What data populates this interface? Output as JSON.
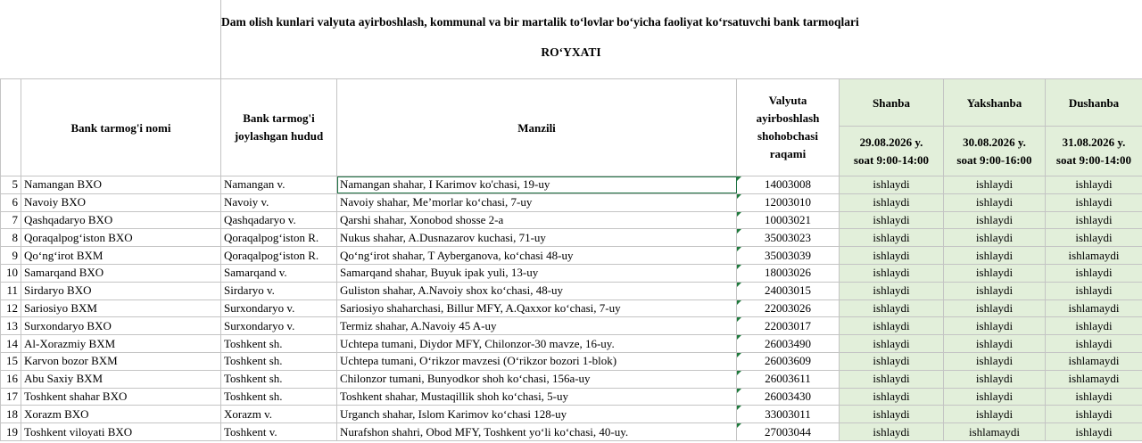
{
  "document": {
    "title": "Dam olish kunlari valyuta ayirboshlash, kommunal va bir martalik toʻlovlar boʻyicha faoliyat koʻrsatuvchi bank tarmoqlari",
    "subtitle": "ROʻYXATI"
  },
  "columns": {
    "bank_name": "Bank tarmog'i nomi",
    "region_line1": "Bank tarmog'i",
    "region_line2": "joylashgan hudud",
    "address": "Manzili",
    "code_line1": "Valyuta",
    "code_line2": "ayirboshlash",
    "code_line3": "shohobchasi",
    "code_line4": "raqami",
    "days": [
      {
        "name": "Shanba",
        "date": "29.08.2026 y.",
        "hours": "soat 9:00-14:00"
      },
      {
        "name": "Yakshanba",
        "date": "30.08.2026 y.",
        "hours": "soat 9:00-16:00"
      },
      {
        "name": "Dushanba",
        "date": "31.08.2026 y.",
        "hours": "soat 9:00-14:00"
      }
    ]
  },
  "rows": [
    {
      "n": "5",
      "bank": "Namangan BXO",
      "region": "Namangan v.",
      "address": "Namangan shahar, I Karimov ko'chasi, 19-uy",
      "code": "14003008",
      "sat": "ishlaydi",
      "sun": "ishlaydi",
      "mon": "ishlaydi"
    },
    {
      "n": "6",
      "bank": "Navoiy BXO",
      "region": "Navoiy v.",
      "address": "Navoiy shahar, Me’morlar ko‘chasi, 7-uy",
      "code": "12003010",
      "sat": "ishlaydi",
      "sun": "ishlaydi",
      "mon": "ishlaydi"
    },
    {
      "n": "7",
      "bank": "Qashqadaryo BXO",
      "region": "Qashqadaryo v.",
      "address": "Qarshi shahar, Xonobod shosse 2-a",
      "code": "10003021",
      "sat": "ishlaydi",
      "sun": "ishlaydi",
      "mon": "ishlaydi"
    },
    {
      "n": "8",
      "bank": "Qoraqalpog‘iston BXO",
      "region": "Qoraqalpog‘iston R.",
      "address": "Nukus shahar, A.Dusnazarov kuchasi, 71-uy",
      "code": "35003023",
      "sat": "ishlaydi",
      "sun": "ishlaydi",
      "mon": "ishlaydi"
    },
    {
      "n": "9",
      "bank": "Qo‘ng‘irot BXM",
      "region": "Qoraqalpog‘iston R.",
      "address": "Qo‘ng‘irot shahar, T Ayberganova, ko‘chasi 48-uy",
      "code": "35003039",
      "sat": "ishlaydi",
      "sun": "ishlaydi",
      "mon": "ishlamaydi"
    },
    {
      "n": "10",
      "bank": "Samarqand BXO",
      "region": "Samarqand v.",
      "address": "Samarqand shahar, Buyuk ipak yuli, 13-uy",
      "code": "18003026",
      "sat": "ishlaydi",
      "sun": "ishlaydi",
      "mon": "ishlaydi"
    },
    {
      "n": "11",
      "bank": "Sirdaryo BXO",
      "region": "Sirdaryo v.",
      "address": "Guliston shahar, A.Navoiy shox ko‘chasi, 48-uy",
      "code": "24003015",
      "sat": "ishlaydi",
      "sun": "ishlaydi",
      "mon": "ishlaydi"
    },
    {
      "n": "12",
      "bank": "Sariosiyo BXM",
      "region": "Surxondaryo v.",
      "address": "Sariosiyo shaharchasi, Billur MFY, A.Qaxxor ko‘chasi, 7-uy",
      "code": "22003026",
      "sat": "ishlaydi",
      "sun": "ishlaydi",
      "mon": "ishlamaydi"
    },
    {
      "n": "13",
      "bank": "Surxondaryo BXO",
      "region": "Surxondaryo v.",
      "address": "Termiz shahar, A.Navoiy 45 A-uy",
      "code": "22003017",
      "sat": "ishlaydi",
      "sun": "ishlaydi",
      "mon": "ishlaydi"
    },
    {
      "n": "14",
      "bank": "Al-Xorazmiy BXM",
      "region": "Toshkent sh.",
      "address": "Uchtepa tumani, Diydor MFY, Chilonzor-30 mavze, 16-uy.",
      "code": "26003490",
      "sat": "ishlaydi",
      "sun": "ishlaydi",
      "mon": "ishlaydi"
    },
    {
      "n": "15",
      "bank": "Karvon bozor BXM",
      "region": "Toshkent sh.",
      "address": "Uchtepa tumani, O‘rikzor mavzesi (O‘rikzor bozori 1-blok)",
      "code": "26003609",
      "sat": "ishlaydi",
      "sun": "ishlaydi",
      "mon": "ishlamaydi"
    },
    {
      "n": "16",
      "bank": "Abu Saxiy BXM",
      "region": "Toshkent sh.",
      "address": "Chilonzor tumani, Bunyodkor shoh ko‘chasi, 156a-uy",
      "code": "26003611",
      "sat": "ishlaydi",
      "sun": "ishlaydi",
      "mon": "ishlamaydi"
    },
    {
      "n": "17",
      "bank": "Toshkent shahar BXO",
      "region": "Toshkent sh.",
      "address": "Toshkent shahar, Mustaqillik shoh ko‘chasi, 5-uy",
      "code": "26003430",
      "sat": "ishlaydi",
      "sun": "ishlaydi",
      "mon": "ishlaydi"
    },
    {
      "n": "18",
      "bank": "Xorazm BXO",
      "region": "Xorazm v.",
      "address": "Urganch shahar, Islom Karimov ko‘chasi 128-uy",
      "code": "33003011",
      "sat": "ishlaydi",
      "sun": "ishlaydi",
      "mon": "ishlaydi"
    },
    {
      "n": "19",
      "bank": "Toshkent viloyati BXO",
      "region": "Toshkent v.",
      "address": "Nurafshon shahri, Obod MFY, Toshkent yo‘li ko‘chasi, 40-uy.",
      "code": "27003044",
      "sat": "ishlaydi",
      "sun": "ishlamaydi",
      "mon": "ishlaydi"
    }
  ],
  "colors": {
    "status_fill": "#e2efda",
    "grid": "#c4c4c4",
    "selection": "#217346"
  }
}
